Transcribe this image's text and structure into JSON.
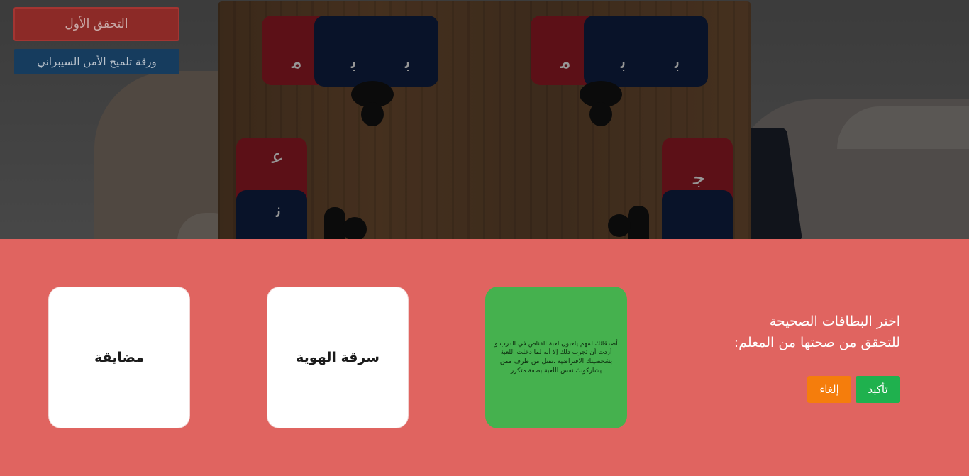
{
  "top_buttons": {
    "first_check": "التحقق الأول",
    "hint_sheet": "ورقة تلميح الأمن السيبراني"
  },
  "board": {
    "card_glyphs": [
      "ﻣ",
      "ﺑ",
      "ﺑ",
      "ﻣ",
      "ﺑ",
      "ﺑ",
      "ﻋ",
      "ﻧ",
      "ﺟ"
    ]
  },
  "modal": {
    "prompt_line1": "اختر البطاقات الصحيحة",
    "prompt_line2": "للتحقق من صحتها من المعلم:",
    "confirm_label": "تأكيد",
    "cancel_label": "إلغاء",
    "cards": [
      {
        "text": "أصدقائك لمهم يلعبون لعبة القناص في الدرب و أردت أن تجرب ذلك إلا أنه لما دخلت اللعبة بشخصيتك الافتراضية .تقتل من طرف ممن يشاركونك نفس اللعبة بصفة متكرر",
        "selected": true
      },
      {
        "text": "سرقة الهوية",
        "selected": false
      },
      {
        "text": "مضايقة",
        "selected": false
      }
    ]
  },
  "colors": {
    "panel_bg": "#e06460",
    "selected_card": "#45b14e",
    "confirm": "#1fb14e",
    "cancel": "#f57d0c"
  }
}
